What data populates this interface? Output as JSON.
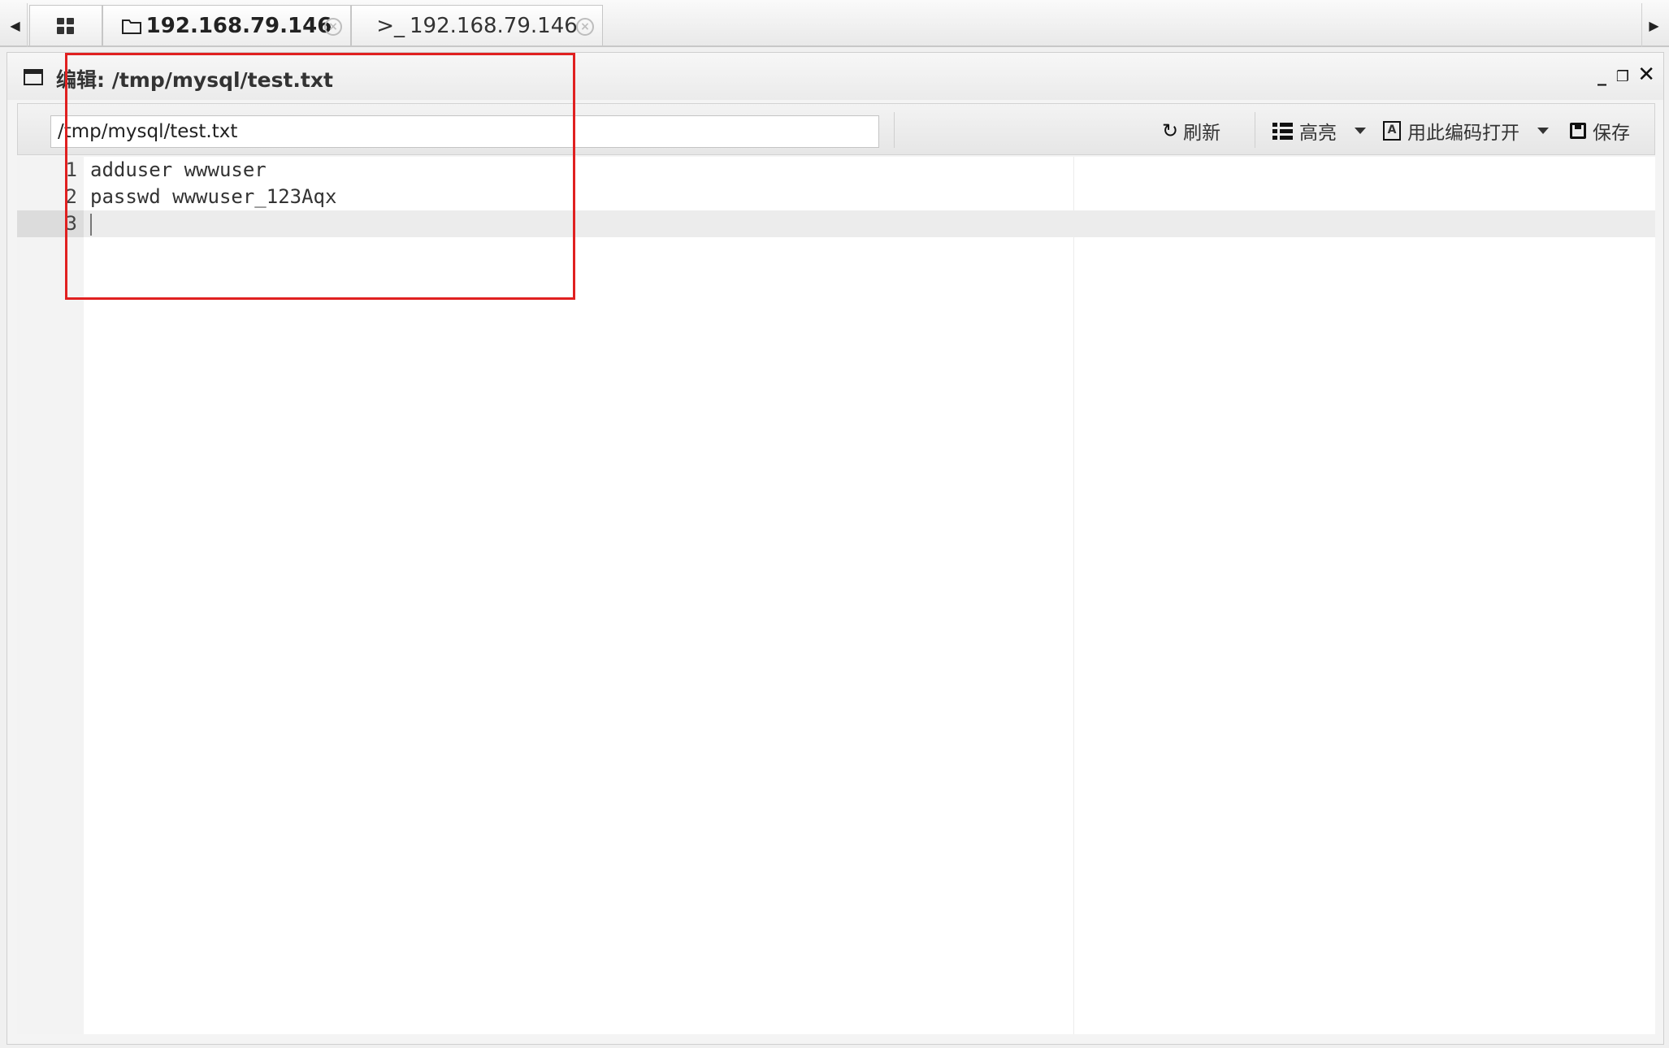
{
  "tabs": {
    "home_icon": "grid-icon",
    "files": {
      "label": "192.168.79.146",
      "icon": "folder-icon",
      "close": "×"
    },
    "terminal": {
      "label": "192.168.79.146",
      "icon": "terminal-icon",
      "icon_text": ">_",
      "close": "×"
    },
    "scroll_left": "◀",
    "scroll_right": "▶"
  },
  "window": {
    "title": "编辑: /tmp/mysql/test.txt",
    "minimize": "_",
    "restore": "❐",
    "close": "✕"
  },
  "toolbar": {
    "path_value": "/tmp/mysql/test.txt",
    "refresh_icon": "↻",
    "refresh_label": "刷新",
    "highlight_label": "高亮",
    "encoding_label": "用此编码打开",
    "save_label": "保存"
  },
  "editor": {
    "line_numbers": [
      "1",
      "2",
      "3"
    ],
    "lines": [
      "adduser wwwuser",
      "passwd wwwuser_123Aqx",
      ""
    ],
    "active_line": 3
  },
  "colors": {
    "annotation": "#e02020",
    "active_line": "#ececec",
    "gutter": "#f3f3f3"
  }
}
